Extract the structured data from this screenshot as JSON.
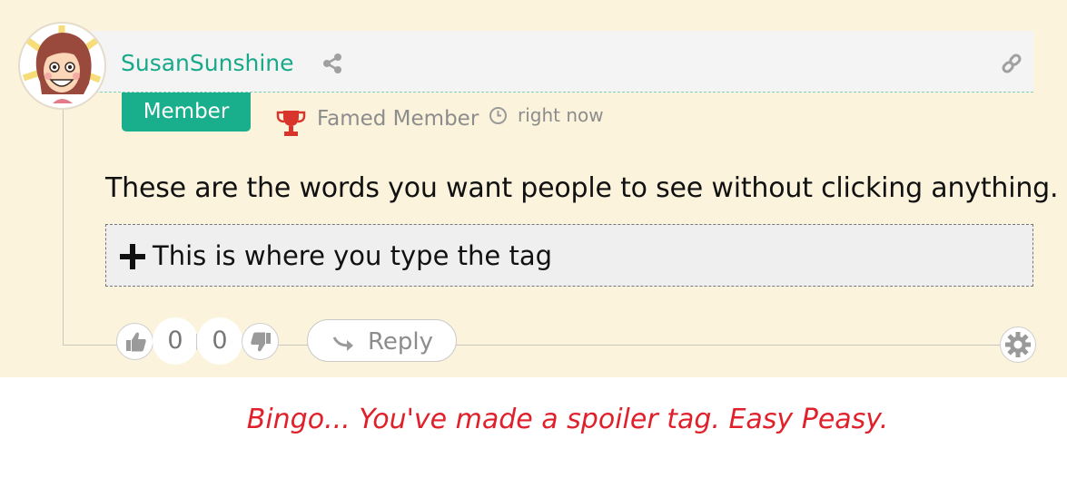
{
  "comment": {
    "username": "SusanSunshine",
    "role_badge": "Member",
    "rank": "Famed Member",
    "time": "right now",
    "body": "These are the words you want people to see without clicking anything.",
    "spoiler_label": "This is where you type the tag",
    "upvotes": "0",
    "downvotes": "0",
    "reply_label": "Reply"
  },
  "icons": {
    "share": "share-icon",
    "link": "link-icon",
    "trophy": "trophy-icon",
    "clock": "clock-icon",
    "plus": "plus-icon",
    "thumbs_up": "thumbs-up-icon",
    "thumbs_down": "thumbs-down-icon",
    "reply": "reply-arrow-icon",
    "settings": "gear-icon"
  },
  "colors": {
    "background": "#fbf3dc",
    "accent": "#1aaf8c",
    "username": "#17a98a",
    "trophy": "#d9342b",
    "caption": "#e0212b"
  },
  "caption": "Bingo... You've made a spoiler tag.  Easy Peasy."
}
